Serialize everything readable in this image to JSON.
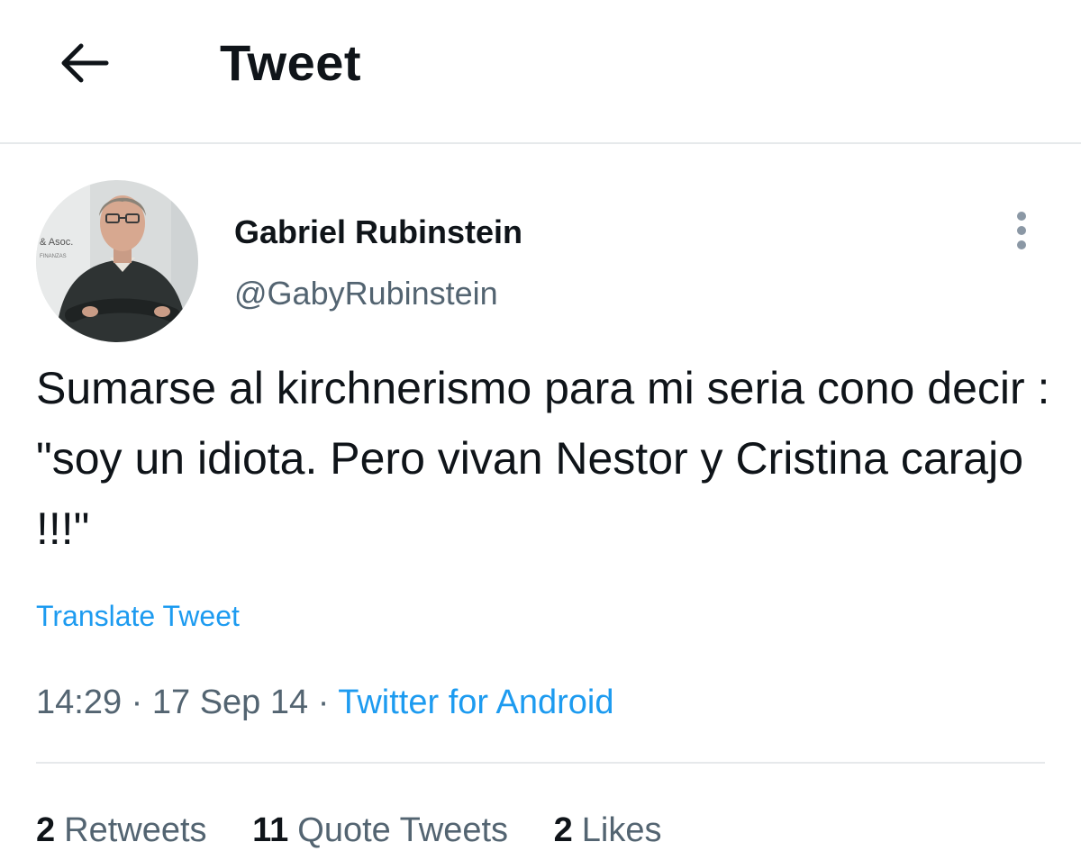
{
  "header": {
    "back_icon": "arrow-left-icon",
    "title": "Tweet"
  },
  "author": {
    "name": "Gabriel Rubinstein",
    "handle": "@GabyRubinstein",
    "avatar_icon": "avatar-photo",
    "avatar_sign_text": "& Asoc.",
    "avatar_sign_subtext": "FINANZAS",
    "more_icon": "more-vertical-icon"
  },
  "tweet": {
    "text": "Sumarse al kirchnerismo para mi seria cono decir : \"soy un idiota. Pero vivan Nestor y Cristina carajo !!!\"",
    "translate_label": "Translate Tweet",
    "time": "14:29",
    "date": "17 Sep 14",
    "separator": "·",
    "source": "Twitter for Android"
  },
  "stats": {
    "retweets_count": "2",
    "retweets_label": "Retweets",
    "quotes_count": "11",
    "quotes_label": "Quote Tweets",
    "likes_count": "2",
    "likes_label": "Likes"
  },
  "colors": {
    "accent": "#1d9bf0",
    "text_primary": "#0f1419",
    "text_secondary": "#536471",
    "divider": "#e6e9eb"
  }
}
